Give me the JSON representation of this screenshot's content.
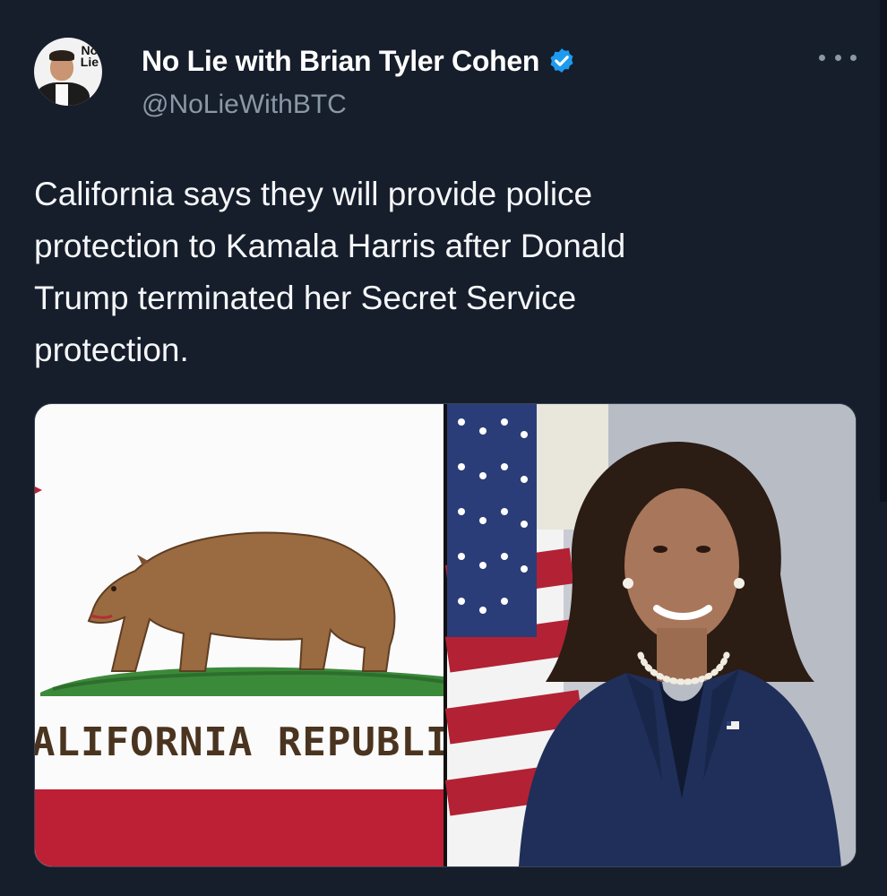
{
  "author": {
    "display_name": "No Lie with Brian Tyler Cohen",
    "handle": "@NoLieWithBTC",
    "avatar_logo_line1": "No",
    "avatar_logo_line2": "Lie"
  },
  "tweet": {
    "text": "California says they will provide police\nprotection to Kamala Harris after Donald\nTrump terminated her Secret Service\nprotection."
  },
  "media": {
    "flag_text": "ALIFORNIA  REPUBLI"
  },
  "colors": {
    "background": "#161d2b",
    "verified_badge": "#1d9bf0",
    "handle": "#8b98a5",
    "flag_red": "#bd1f35",
    "bear_brown": "#9a6a40"
  },
  "icons": {
    "verified": "verified-badge-icon",
    "more": "more-options-icon"
  }
}
